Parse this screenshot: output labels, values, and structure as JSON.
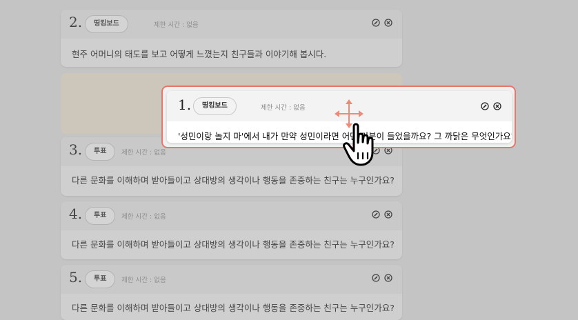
{
  "cards": [
    {
      "number": "2.",
      "type": "띵킹보드",
      "limit": "제한 시간 : 없음",
      "question": "현주 어머니의 태도를 보고 어떻게 느꼈는지 친구들과 이야기해 봅시다."
    },
    {
      "number": "3.",
      "type": "투표",
      "limit": "제한 시간 : 없음",
      "question": "다른 문화를 이해하며 받아들이고 상대방의 생각이나 행동을 존중하는 친구는 누구인가요?"
    },
    {
      "number": "4.",
      "type": "투표",
      "limit": "제한 시간 : 없음",
      "question": "다른 문화를 이해하며 받아들이고 상대방의 생각이나 행동을 존중하는 친구는 누구인가요?"
    },
    {
      "number": "5.",
      "type": "투표",
      "limit": "제한 시간 : 없음",
      "question": "다른 문화를 이해하며 받아들이고 상대방의 생각이나 행동을 존중하는 친구는 누구인가요?"
    }
  ],
  "dragging_card": {
    "number": "1.",
    "type": "띵킹보드",
    "limit": "제한 시간 : 없음",
    "question": "'성민이랑 놀지 마'에서 내가 만약 성민이라면 어떤 기분이 들었을까요? 그 까닭은 무엇인가요?"
  },
  "icons": {
    "edit": "edit-circle-icon",
    "delete": "delete-circle-icon",
    "move": "move-arrows-icon",
    "cursor": "hand-pointer-icon"
  },
  "colors": {
    "drag_border": "#ea7568",
    "placeholder": "#ccc7ba",
    "move_arrows": "#f08a78"
  }
}
